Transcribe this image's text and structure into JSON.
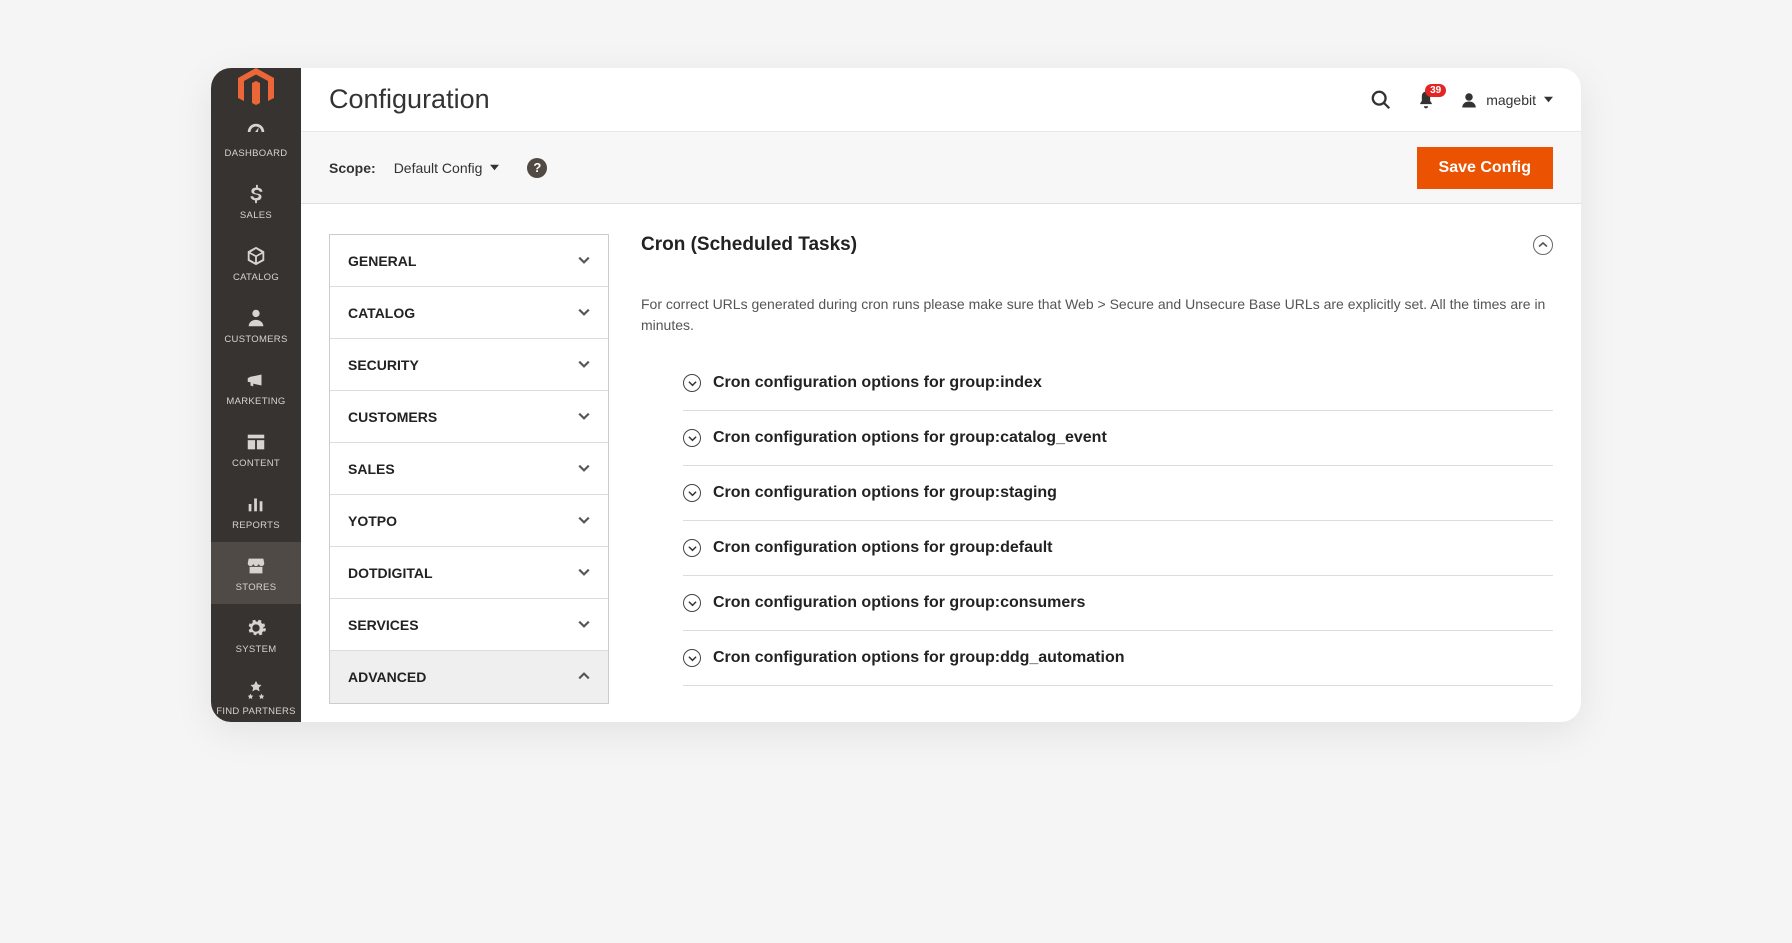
{
  "header": {
    "title": "Configuration",
    "notification_count": "39",
    "user_name": "magebit"
  },
  "sidebar": {
    "items": [
      {
        "label": "DASHBOARD",
        "icon": "dashboard"
      },
      {
        "label": "SALES",
        "icon": "dollar"
      },
      {
        "label": "CATALOG",
        "icon": "box"
      },
      {
        "label": "CUSTOMERS",
        "icon": "person"
      },
      {
        "label": "MARKETING",
        "icon": "megaphone"
      },
      {
        "label": "CONTENT",
        "icon": "layout"
      },
      {
        "label": "REPORTS",
        "icon": "bars"
      },
      {
        "label": "STORES",
        "icon": "store",
        "active": true
      },
      {
        "label": "SYSTEM",
        "icon": "gear"
      },
      {
        "label": "FIND PARTNERS",
        "icon": "partners"
      }
    ]
  },
  "scope": {
    "label": "Scope:",
    "value": "Default Config",
    "save_label": "Save Config"
  },
  "config_nav": [
    {
      "label": "GENERAL",
      "expanded": false
    },
    {
      "label": "CATALOG",
      "expanded": false
    },
    {
      "label": "SECURITY",
      "expanded": false
    },
    {
      "label": "CUSTOMERS",
      "expanded": false
    },
    {
      "label": "SALES",
      "expanded": false
    },
    {
      "label": "YOTPO",
      "expanded": false
    },
    {
      "label": "DOTDIGITAL",
      "expanded": false
    },
    {
      "label": "SERVICES",
      "expanded": false
    },
    {
      "label": "ADVANCED",
      "expanded": true
    }
  ],
  "panel": {
    "title": "Cron (Scheduled Tasks)",
    "description": "For correct URLs generated during cron runs please make sure that Web > Secure and Unsecure Base URLs are explicitly set. All the times are in minutes.",
    "groups": [
      "Cron configuration options for group:index",
      "Cron configuration options for group:catalog_event",
      "Cron configuration options for group:staging",
      "Cron configuration options for group:default",
      "Cron configuration options for group:consumers",
      "Cron configuration options for group:ddg_automation"
    ]
  }
}
